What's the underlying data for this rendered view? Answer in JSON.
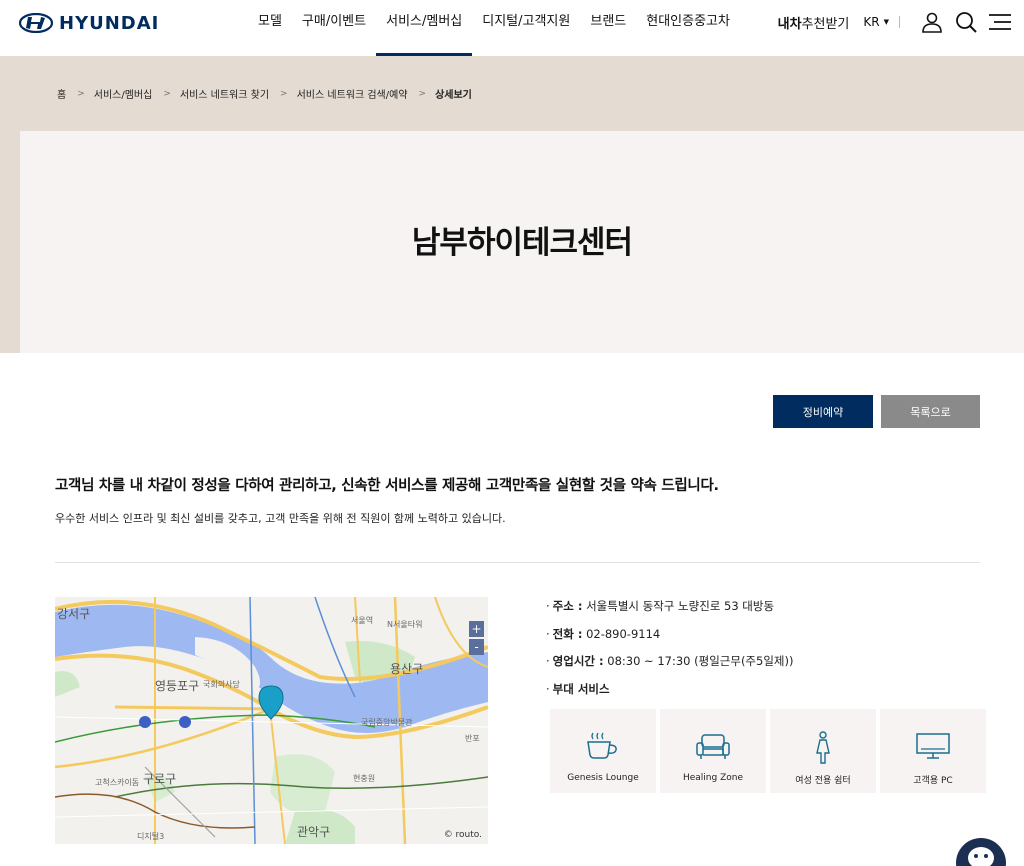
{
  "header": {
    "logo_text": "HYUNDAI",
    "nav": [
      "모델",
      "구매/이벤트",
      "서비스/멤버십",
      "디지털/고객지원",
      "브랜드",
      "현대인증중고차"
    ],
    "active_nav": "서비스/멤버십",
    "rec_bold": "내차",
    "rec_rest": "추천받기",
    "lang": "KR",
    "icons": [
      "user-icon",
      "search-icon",
      "menu-icon"
    ]
  },
  "breadcrumb": [
    "홈",
    "서비스/멤버십",
    "서비스 네트워크 찾기",
    "서비스 네트워크 검색/예약",
    "상세보기"
  ],
  "page_title": "남부하이테크센터",
  "buttons": {
    "reserve": "정비예약",
    "list": "목록으로"
  },
  "intro": {
    "title": "고객님 차를 내 차같이 정성을 다하여 관리하고, 신속한 서비스를 제공해 고객만족을 실현할 것을 약속 드립니다.",
    "subtitle": "우수한 서비스 인프라 및 최신 설비를 갖추고, 고객 만족을 위해 전 직원이 함께 노력하고 있습니다."
  },
  "map": {
    "labels": [
      "강서구",
      "영등포구",
      "국회의사당",
      "용산구",
      "서울역",
      "N서울타워",
      "구로구",
      "고척스카이돔",
      "관악구",
      "현충원",
      "국립중앙박물관",
      "반포",
      "디지털3"
    ],
    "zoom_in": "+",
    "zoom_out": "-",
    "credit": "© routo."
  },
  "info": {
    "address_label": "주소 :",
    "address": "서울특별시 동작구 노량진로 53 대방동",
    "phone_label": "전화 :",
    "phone": "02-890-9114",
    "hours_label": "영업시간 :",
    "hours": "08:30 ~ 17:30 (평일근무(주5일제))",
    "facilities_label": "부대 서비스"
  },
  "facilities": [
    {
      "label": "Genesis Lounge",
      "icon": "coffee-cup-icon"
    },
    {
      "label": "Healing Zone",
      "icon": "sofa-icon"
    },
    {
      "label": "여성 전용 쉼터",
      "icon": "woman-icon"
    },
    {
      "label": "고객용 PC",
      "icon": "monitor-icon"
    }
  ],
  "colors": {
    "brand": "#002c5f",
    "hero_bg": "#e4dcd3",
    "hero_box": "#f6f3f2",
    "list_button": "#8a8a8a",
    "marker": "#1aa0c8"
  }
}
